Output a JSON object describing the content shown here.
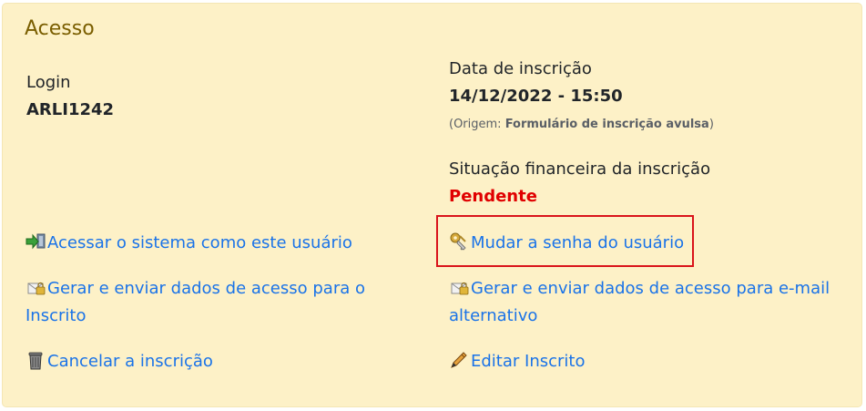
{
  "section": {
    "title": "Acesso"
  },
  "login": {
    "label": "Login",
    "value": "ARLI1242"
  },
  "registration": {
    "label": "Data de inscrição",
    "date": "14/12/2022 - 15:50",
    "origin_prefix": "(Origem: ",
    "origin_value": "Formulário de inscrição avulsa",
    "origin_suffix": ")"
  },
  "financial": {
    "label": "Situação financeira da inscrição",
    "status": "Pendente",
    "status_color": "#e00000"
  },
  "actions": {
    "access_system": {
      "label": "Acessar o sistema como este usuário",
      "icon": "login-arrow-icon"
    },
    "change_password": {
      "label": "Mudar a senha do usuário",
      "icon": "keys-icon"
    },
    "send_access_data": {
      "line1": "Gerar e enviar dados de acesso para o",
      "line2": "Inscrito",
      "icon": "envelope-lock-icon"
    },
    "send_access_data_alt": {
      "line1": "Gerar e enviar dados de acesso para e-mail",
      "line2": "alternativo",
      "icon": "envelope-lock-icon"
    },
    "cancel_registration": {
      "label": "Cancelar a inscrição",
      "icon": "trash-can-icon"
    },
    "edit_registrant": {
      "label": "Editar Inscrito",
      "icon": "pencil-icon"
    }
  },
  "colors": {
    "panel_bg": "#fdf1c7",
    "title": "#7a5e00",
    "link": "#1a73e8",
    "highlight_border": "#d9141b"
  }
}
